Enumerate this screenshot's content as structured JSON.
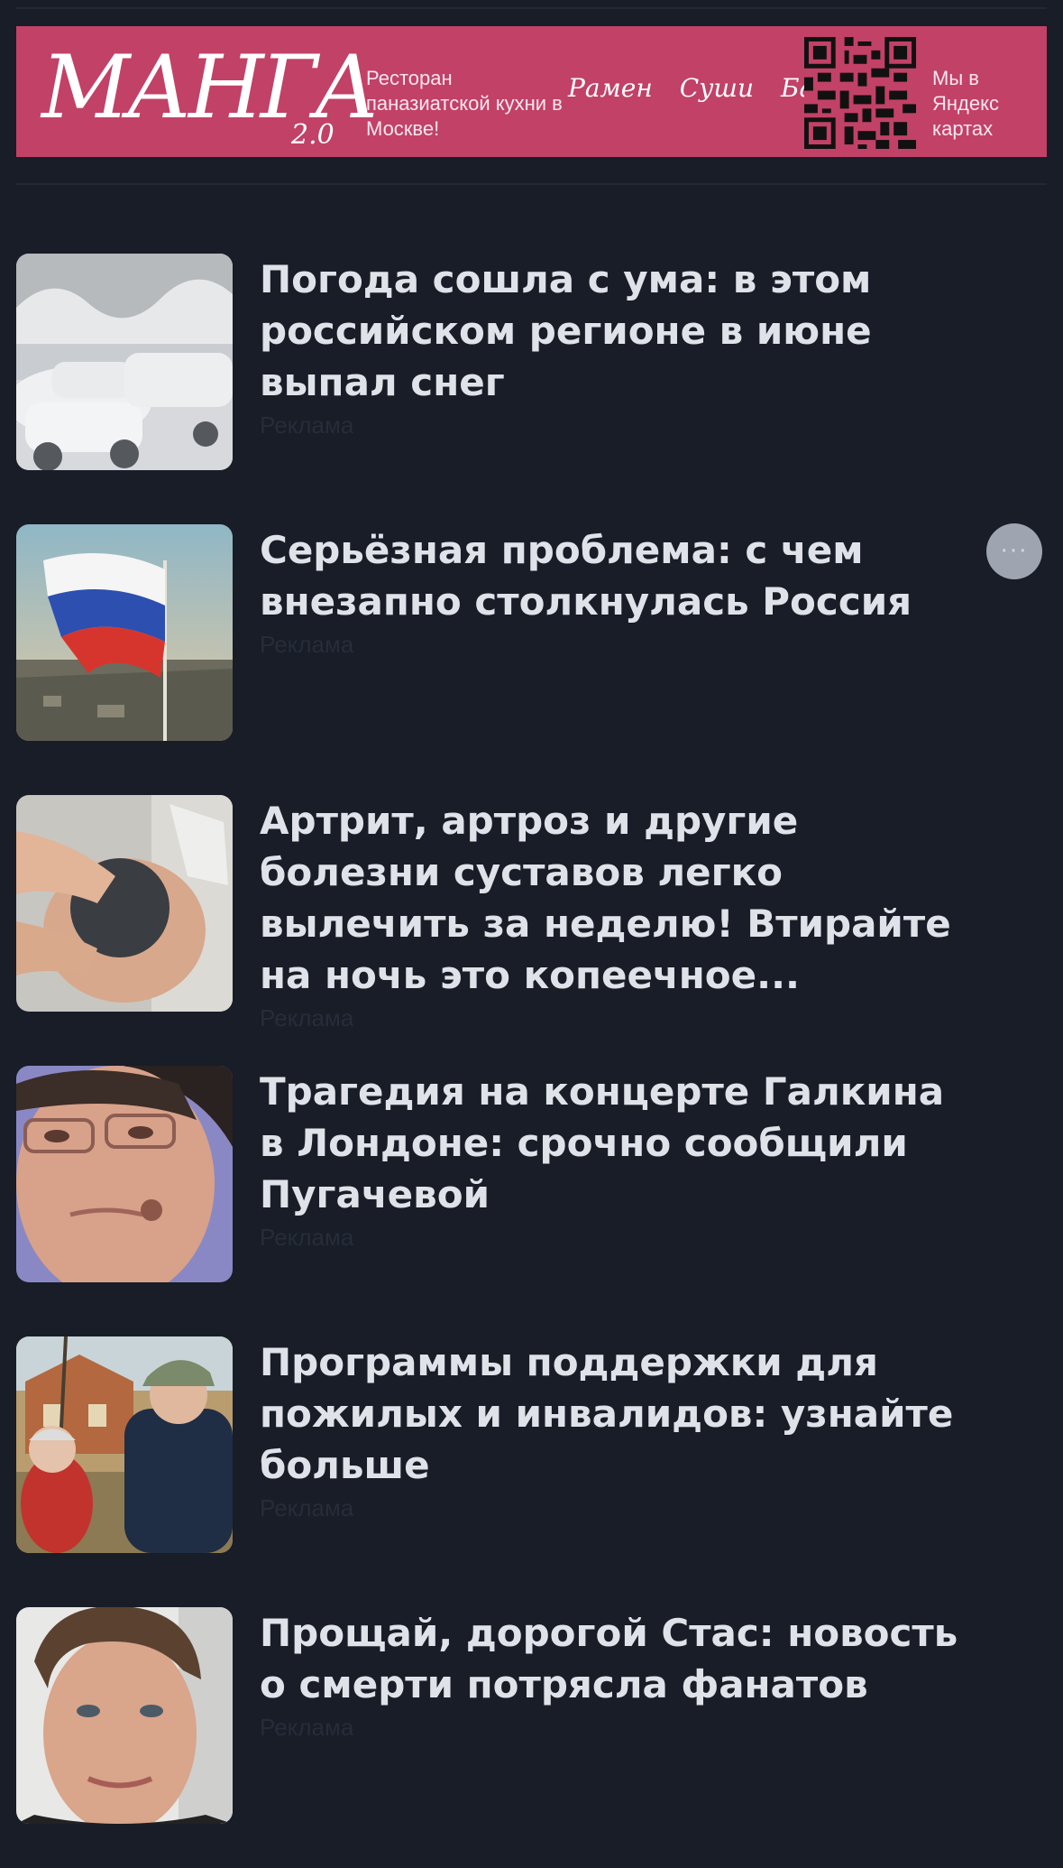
{
  "banner": {
    "logo": "МАНГА",
    "logo_version": "2.0",
    "description": "Ресторан паназиатской кухни в Москве!",
    "menu": [
      "Рамен",
      "Суши",
      "Бар"
    ],
    "maps_text": "Мы в Яндекс картах",
    "background_color": "#c24167",
    "qr_icon": "qr-code-icon"
  },
  "feed": {
    "ad_label": "Реклама",
    "items": [
      {
        "title": "Погода сошла с ума: в этом российском регионе в июне выпал снег",
        "thumbnail": "snow-covered-cars"
      },
      {
        "title": "Серьёзная проблема: с чем внезапно столкнулась Россия",
        "thumbnail": "russian-flag-over-city"
      },
      {
        "title": "Артрит, артроз и другие болезни суставов легко вылечить за неделю! Втирайте на ночь это копеечное...",
        "thumbnail": "knee-treatment"
      },
      {
        "title": "Трагедия на концерте Галкина в Лондоне: срочно сообщили Пугачевой",
        "thumbnail": "man-with-glasses-portrait"
      },
      {
        "title": "Программы поддержки для пожилых и инвалидов: узнайте больше",
        "thumbnail": "elderly-couple-on-swing"
      },
      {
        "title": "Прощай, дорогой Стас: новость о смерти потрясла фанатов",
        "thumbnail": "young-man-portrait"
      }
    ]
  },
  "more_button": {
    "label": "···",
    "icon": "more-icon"
  }
}
